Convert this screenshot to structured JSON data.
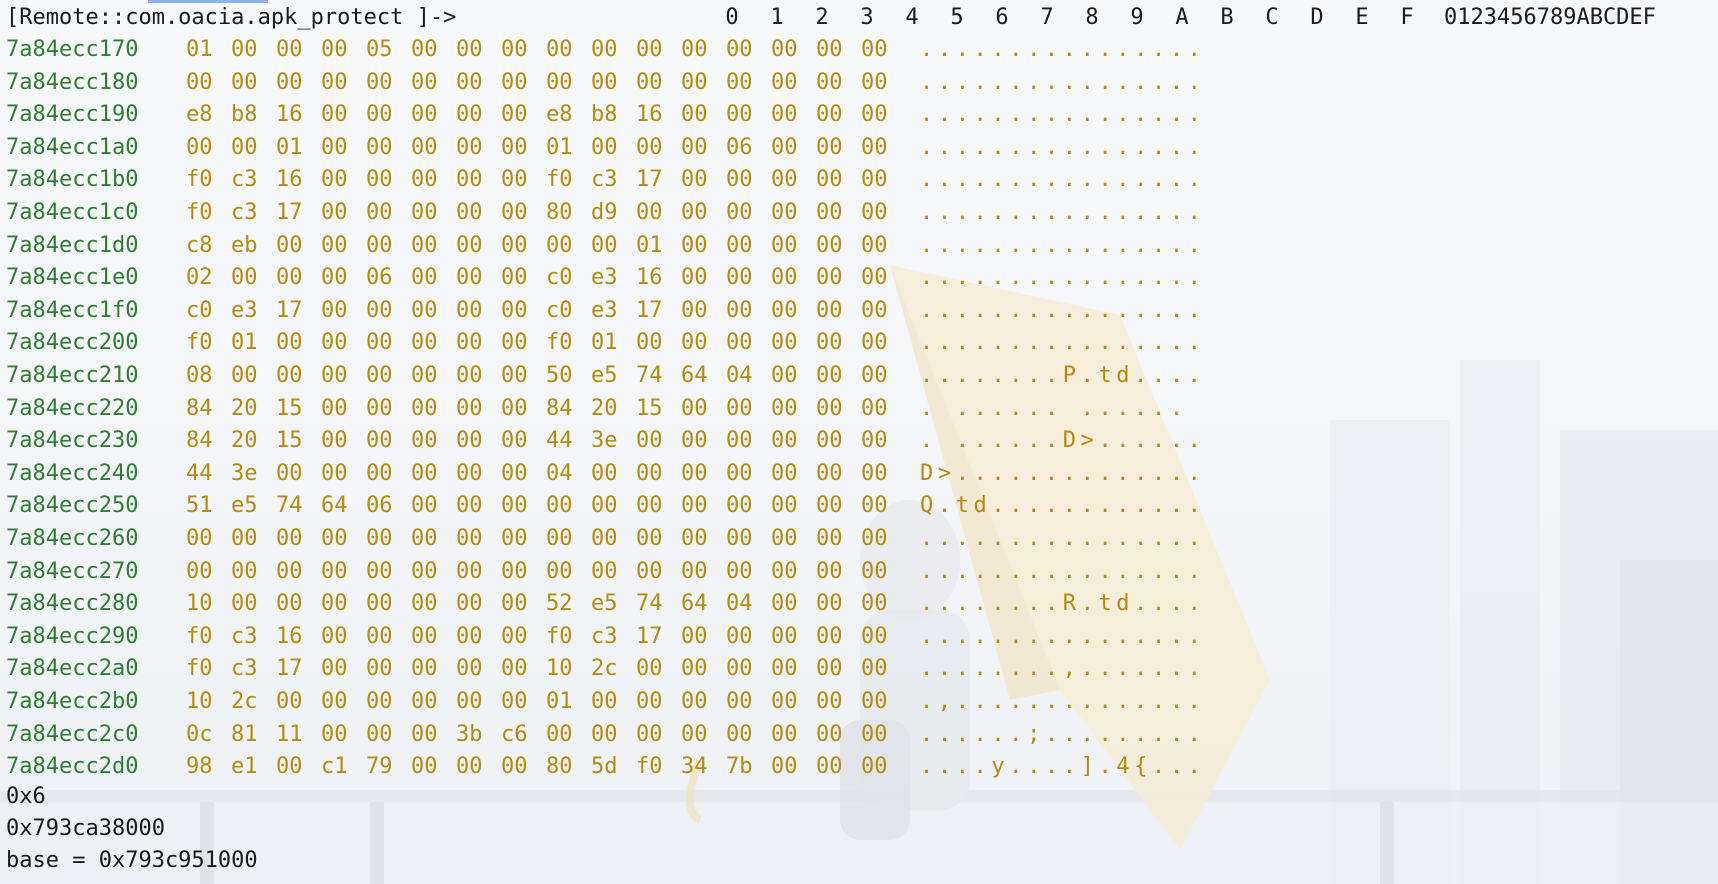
{
  "prompt": "[Remote::com.oacia.apk_protect ]->",
  "header": {
    "columns": [
      "0",
      "1",
      "2",
      "3",
      "4",
      "5",
      "6",
      "7",
      "8",
      "9",
      "A",
      "B",
      "C",
      "D",
      "E",
      "F"
    ],
    "ascii_header": "0123456789ABCDEF"
  },
  "rows": [
    {
      "addr": "7a84ecc170",
      "bytes": [
        "01",
        "00",
        "00",
        "00",
        "05",
        "00",
        "00",
        "00",
        "00",
        "00",
        "00",
        "00",
        "00",
        "00",
        "00",
        "00"
      ],
      "ascii": "................"
    },
    {
      "addr": "7a84ecc180",
      "bytes": [
        "00",
        "00",
        "00",
        "00",
        "00",
        "00",
        "00",
        "00",
        "00",
        "00",
        "00",
        "00",
        "00",
        "00",
        "00",
        "00"
      ],
      "ascii": "................"
    },
    {
      "addr": "7a84ecc190",
      "bytes": [
        "e8",
        "b8",
        "16",
        "00",
        "00",
        "00",
        "00",
        "00",
        "e8",
        "b8",
        "16",
        "00",
        "00",
        "00",
        "00",
        "00"
      ],
      "ascii": "................"
    },
    {
      "addr": "7a84ecc1a0",
      "bytes": [
        "00",
        "00",
        "01",
        "00",
        "00",
        "00",
        "00",
        "00",
        "01",
        "00",
        "00",
        "00",
        "06",
        "00",
        "00",
        "00"
      ],
      "ascii": "................"
    },
    {
      "addr": "7a84ecc1b0",
      "bytes": [
        "f0",
        "c3",
        "16",
        "00",
        "00",
        "00",
        "00",
        "00",
        "f0",
        "c3",
        "17",
        "00",
        "00",
        "00",
        "00",
        "00"
      ],
      "ascii": "................"
    },
    {
      "addr": "7a84ecc1c0",
      "bytes": [
        "f0",
        "c3",
        "17",
        "00",
        "00",
        "00",
        "00",
        "00",
        "80",
        "d9",
        "00",
        "00",
        "00",
        "00",
        "00",
        "00"
      ],
      "ascii": "................"
    },
    {
      "addr": "7a84ecc1d0",
      "bytes": [
        "c8",
        "eb",
        "00",
        "00",
        "00",
        "00",
        "00",
        "00",
        "00",
        "00",
        "01",
        "00",
        "00",
        "00",
        "00",
        "00"
      ],
      "ascii": "................"
    },
    {
      "addr": "7a84ecc1e0",
      "bytes": [
        "02",
        "00",
        "00",
        "00",
        "06",
        "00",
        "00",
        "00",
        "c0",
        "e3",
        "16",
        "00",
        "00",
        "00",
        "00",
        "00"
      ],
      "ascii": "................"
    },
    {
      "addr": "7a84ecc1f0",
      "bytes": [
        "c0",
        "e3",
        "17",
        "00",
        "00",
        "00",
        "00",
        "00",
        "c0",
        "e3",
        "17",
        "00",
        "00",
        "00",
        "00",
        "00"
      ],
      "ascii": "................"
    },
    {
      "addr": "7a84ecc200",
      "bytes": [
        "f0",
        "01",
        "00",
        "00",
        "00",
        "00",
        "00",
        "00",
        "f0",
        "01",
        "00",
        "00",
        "00",
        "00",
        "00",
        "00"
      ],
      "ascii": "................"
    },
    {
      "addr": "7a84ecc210",
      "bytes": [
        "08",
        "00",
        "00",
        "00",
        "00",
        "00",
        "00",
        "00",
        "50",
        "e5",
        "74",
        "64",
        "04",
        "00",
        "00",
        "00"
      ],
      "ascii": "........P.td...."
    },
    {
      "addr": "7a84ecc220",
      "bytes": [
        "84",
        "20",
        "15",
        "00",
        "00",
        "00",
        "00",
        "00",
        "84",
        "20",
        "15",
        "00",
        "00",
        "00",
        "00",
        "00"
      ],
      "ascii": ". ...... ......"
    },
    {
      "addr": "7a84ecc230",
      "bytes": [
        "84",
        "20",
        "15",
        "00",
        "00",
        "00",
        "00",
        "00",
        "44",
        "3e",
        "00",
        "00",
        "00",
        "00",
        "00",
        "00"
      ],
      "ascii": ". ......D>......"
    },
    {
      "addr": "7a84ecc240",
      "bytes": [
        "44",
        "3e",
        "00",
        "00",
        "00",
        "00",
        "00",
        "00",
        "04",
        "00",
        "00",
        "00",
        "00",
        "00",
        "00",
        "00"
      ],
      "ascii": "D>.............."
    },
    {
      "addr": "7a84ecc250",
      "bytes": [
        "51",
        "e5",
        "74",
        "64",
        "06",
        "00",
        "00",
        "00",
        "00",
        "00",
        "00",
        "00",
        "00",
        "00",
        "00",
        "00"
      ],
      "ascii": "Q.td............"
    },
    {
      "addr": "7a84ecc260",
      "bytes": [
        "00",
        "00",
        "00",
        "00",
        "00",
        "00",
        "00",
        "00",
        "00",
        "00",
        "00",
        "00",
        "00",
        "00",
        "00",
        "00"
      ],
      "ascii": "................"
    },
    {
      "addr": "7a84ecc270",
      "bytes": [
        "00",
        "00",
        "00",
        "00",
        "00",
        "00",
        "00",
        "00",
        "00",
        "00",
        "00",
        "00",
        "00",
        "00",
        "00",
        "00"
      ],
      "ascii": "................"
    },
    {
      "addr": "7a84ecc280",
      "bytes": [
        "10",
        "00",
        "00",
        "00",
        "00",
        "00",
        "00",
        "00",
        "52",
        "e5",
        "74",
        "64",
        "04",
        "00",
        "00",
        "00"
      ],
      "ascii": "........R.td...."
    },
    {
      "addr": "7a84ecc290",
      "bytes": [
        "f0",
        "c3",
        "16",
        "00",
        "00",
        "00",
        "00",
        "00",
        "f0",
        "c3",
        "17",
        "00",
        "00",
        "00",
        "00",
        "00"
      ],
      "ascii": "................"
    },
    {
      "addr": "7a84ecc2a0",
      "bytes": [
        "f0",
        "c3",
        "17",
        "00",
        "00",
        "00",
        "00",
        "00",
        "10",
        "2c",
        "00",
        "00",
        "00",
        "00",
        "00",
        "00"
      ],
      "ascii": "........,......."
    },
    {
      "addr": "7a84ecc2b0",
      "bytes": [
        "10",
        "2c",
        "00",
        "00",
        "00",
        "00",
        "00",
        "00",
        "01",
        "00",
        "00",
        "00",
        "00",
        "00",
        "00",
        "00"
      ],
      "ascii": ".,.............."
    },
    {
      "addr": "7a84ecc2c0",
      "bytes": [
        "0c",
        "81",
        "11",
        "00",
        "00",
        "00",
        "3b",
        "c6",
        "00",
        "00",
        "00",
        "00",
        "00",
        "00",
        "00",
        "00"
      ],
      "ascii": "......;........."
    },
    {
      "addr": "7a84ecc2d0",
      "bytes": [
        "98",
        "e1",
        "00",
        "c1",
        "79",
        "00",
        "00",
        "00",
        "80",
        "5d",
        "f0",
        "34",
        "7b",
        "00",
        "00",
        "00"
      ],
      "ascii": "....y....].4{..."
    }
  ],
  "output": [
    "0x6",
    "0x793ca38000",
    "base = 0x793c951000"
  ],
  "colors": {
    "address": "#2e7d32",
    "bytes": "#b38b12",
    "prompt": "#1a1a1a",
    "background": "#f5f6f8"
  }
}
